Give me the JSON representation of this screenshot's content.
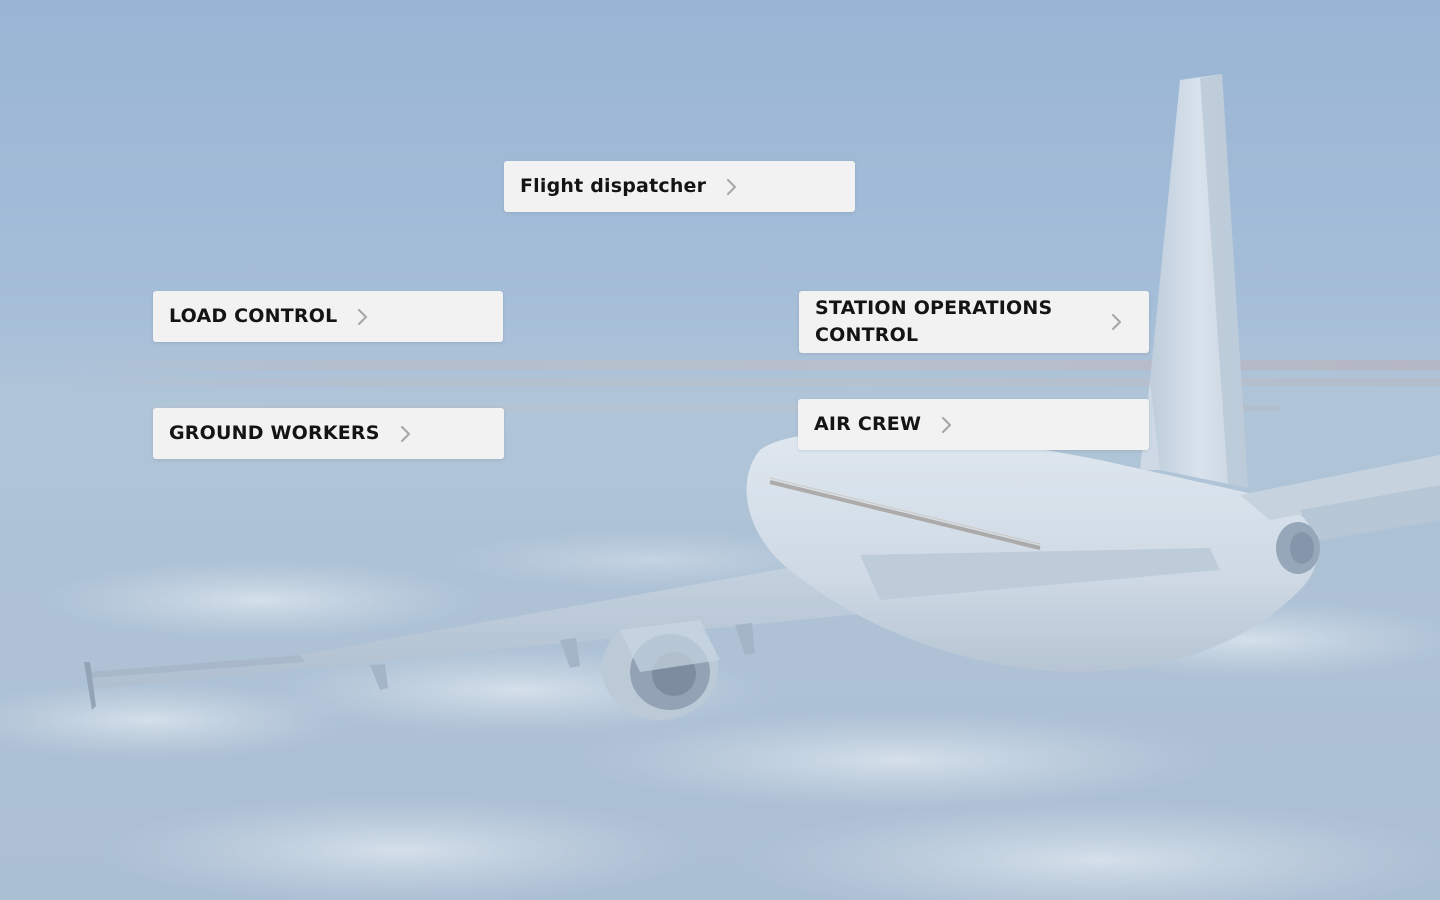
{
  "background": {
    "description_icon": "airplane-in-sky-photo",
    "sky_top_color": "#8aa9cf",
    "sky_horizon_color": "#a9c0d6",
    "cloud_color": "#c8d6e3"
  },
  "roles": {
    "flight_dispatcher": {
      "label": "Flight dispatcher",
      "icon": "chevron-right-icon"
    },
    "load_control": {
      "label": "LOAD CONTROL",
      "icon": "chevron-right-icon"
    },
    "station_operations_control": {
      "label": "STATION OPERATIONS CONTROL",
      "icon": "chevron-right-icon"
    },
    "ground_workers": {
      "label": "GROUND WORKERS",
      "icon": "chevron-right-icon"
    },
    "air_crew": {
      "label": "AIR CREW",
      "icon": "chevron-right-icon"
    }
  },
  "colors": {
    "card_background": "#f2f2f2",
    "card_text": "#141414",
    "chevron": "#a8a8a8"
  }
}
